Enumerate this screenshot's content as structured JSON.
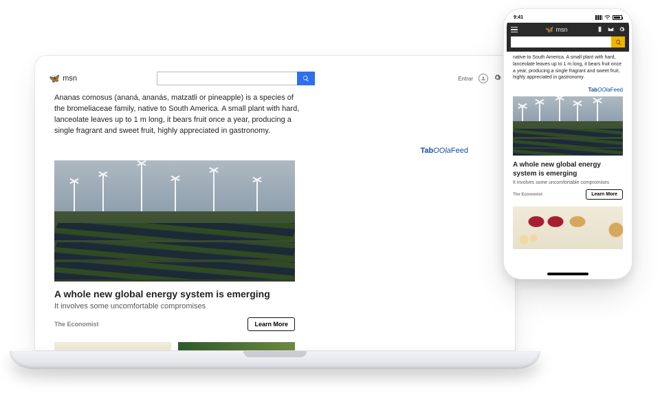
{
  "desktop": {
    "brand": "msn",
    "search_placeholder": "",
    "sign_in": "Entrar",
    "article": "Ananas comosus (ananá, ananás, matzatli or pineapple) is a species of the bromeliaceae family, native to South America. A small plant with hard, lanceolate leaves up to 1 m long, it bears fruit once a year, producing a single fragrant and sweet fruit, highly appreciated in gastronomy.",
    "feed_label_a": "Tab",
    "feed_label_b": "OOla",
    "feed_label_c": "Feed",
    "card": {
      "title": "A whole new global energy system is emerging",
      "subtitle": "It involves some uncomfortable compromises",
      "brand": "The Economist",
      "cta": "Learn More"
    }
  },
  "phone": {
    "time": "9:41",
    "brand": "msn",
    "search_placeholder": "",
    "article": "native to South America. A small plant with hard, lanceolate leaves up to 1 m long, it bears fruit once a year, producing a single fragrant and sweet fruit, highly appreciated in gastronomy.",
    "feed_label_a": "Tab",
    "feed_label_b": "OOla",
    "feed_label_c": "Feed",
    "card": {
      "title": "A whole new global energy system is emerging",
      "subtitle": "It involves some uncomfortable compromises",
      "brand": "The Economist",
      "cta": "Learn More"
    }
  }
}
